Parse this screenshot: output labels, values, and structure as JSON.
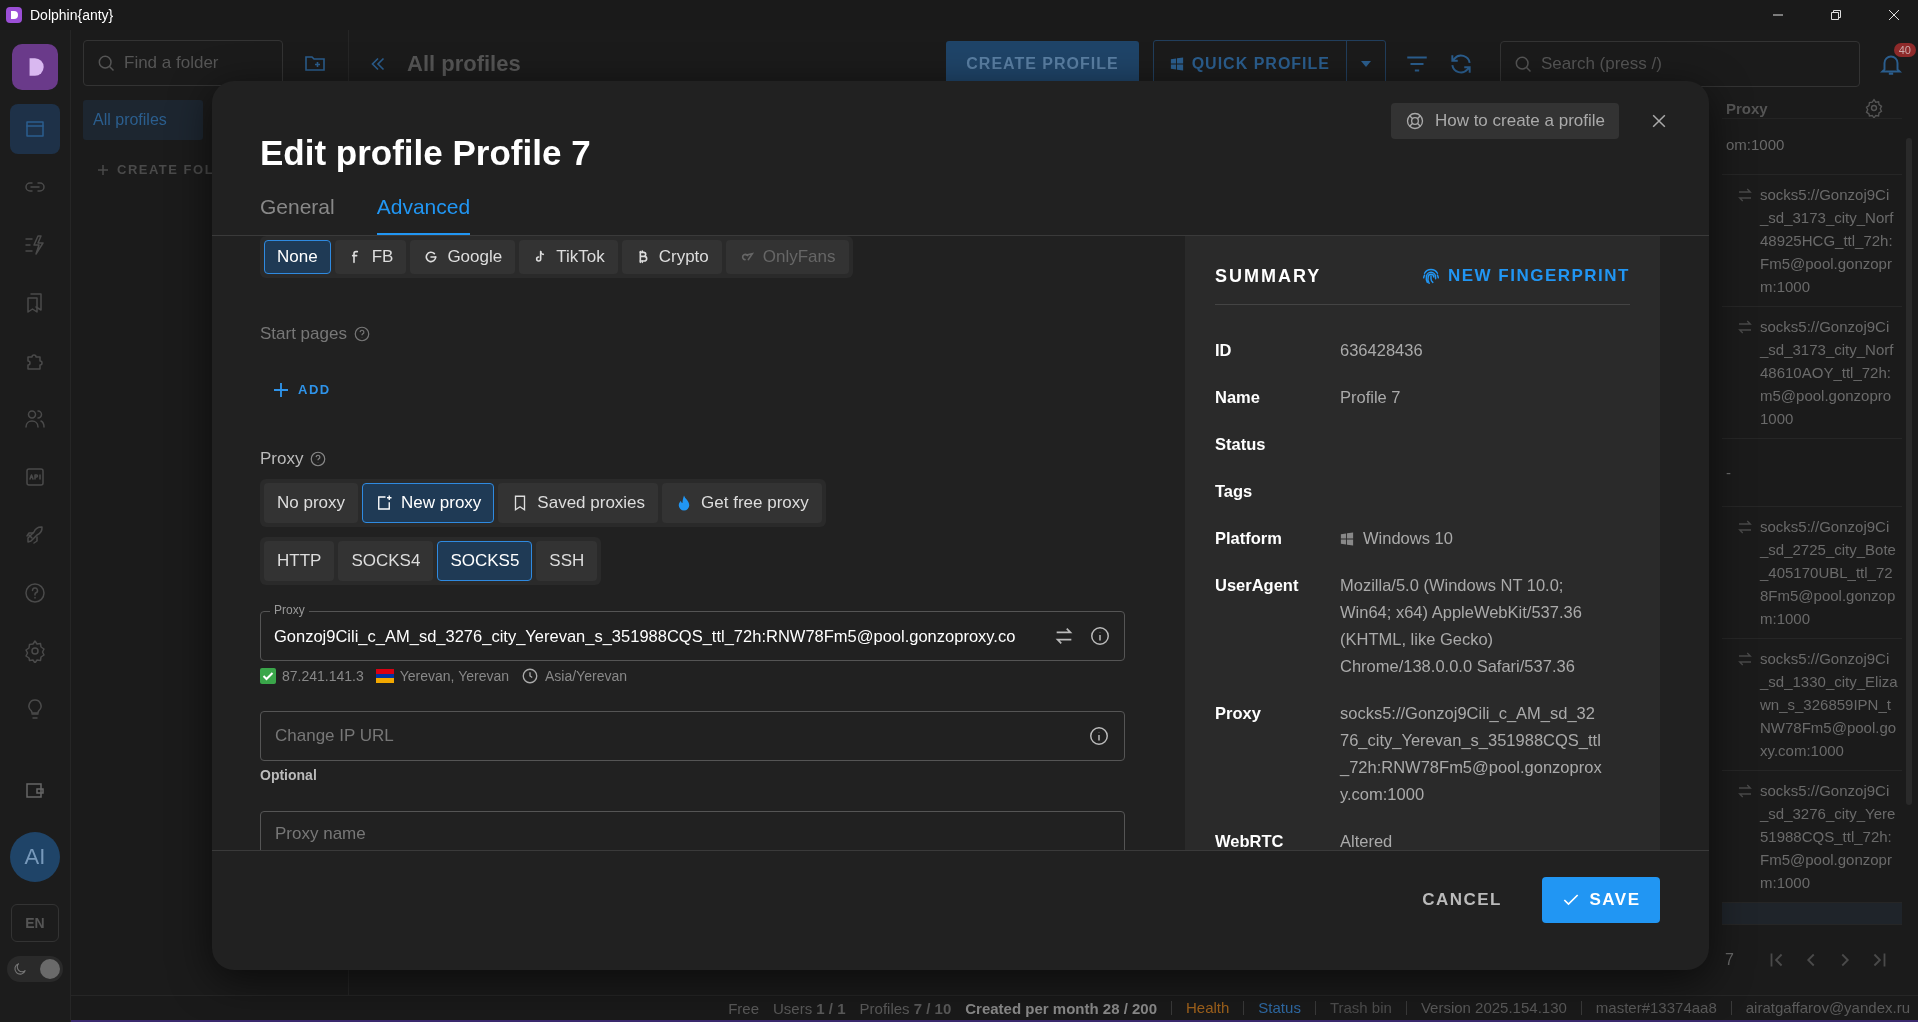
{
  "window": {
    "title": "Dolphin{anty}"
  },
  "rail": {
    "items": [
      {
        "selected": true
      },
      {
        "selected": false
      },
      {
        "selected": false
      },
      {
        "selected": false
      },
      {
        "selected": false
      },
      {
        "selected": false
      },
      {
        "selected": false
      },
      {
        "selected": false
      },
      {
        "selected": false
      },
      {
        "selected": false
      },
      {
        "selected": false
      }
    ],
    "avatar": "AI",
    "language": "EN",
    "dark_mode": true
  },
  "folders": {
    "search_placeholder": "Find a folder",
    "items": [
      {
        "label": "All profiles",
        "selected": true
      }
    ],
    "create": "CREATE FOL"
  },
  "toolbar": {
    "title": "All profiles",
    "create_button": "CREATE PROFILE",
    "quick_button": "QUICK PROFILE",
    "search_placeholder": "Search (press /)",
    "notifications": "40"
  },
  "table": {
    "column": "Proxy",
    "rows": [
      {
        "text": "om:1000",
        "swap": false,
        "selected": false
      },
      {
        "text": "socks5://Gonzoj9Ci\n_sd_3173_city_Norf\n48925HCG_ttl_72h:\nFm5@pool.gonzopr\nm:1000",
        "swap": true,
        "selected": false
      },
      {
        "text": "socks5://Gonzoj9Ci\n_sd_3173_city_Norf\n48610AOY_ttl_72h:\nm5@pool.gonzopro\n1000",
        "swap": true,
        "selected": false
      },
      {
        "text": "-",
        "swap": false,
        "selected": false
      },
      {
        "text": "socks5://Gonzoj9Ci\n_sd_2725_city_Bote\n_405170UBL_ttl_72\n8Fm5@pool.gonzop\nm:1000",
        "swap": true,
        "selected": false
      },
      {
        "text": "socks5://Gonzoj9Ci\n_sd_1330_city_Eliza\nwn_s_326859IPN_t\nNW78Fm5@pool.go\nxy.com:1000",
        "swap": true,
        "selected": false
      },
      {
        "text": "socks5://Gonzoj9Ci\n_sd_3276_city_Yere\n51988CQS_ttl_72h:\nFm5@pool.gonzopr\nm:1000",
        "swap": true,
        "selected": false
      },
      {
        "swap": false,
        "selected": true
      }
    ],
    "page": "7"
  },
  "status_bar": {
    "items": [
      {
        "text": "Free",
        "color": "#5a5a5a",
        "separator": false
      },
      {
        "text": "Users **1 / 1**",
        "color": "#5a5a5a",
        "separator": false
      },
      {
        "text": "Profiles **7 / 10**",
        "color": "#5a5a5a",
        "separator": false
      },
      {
        "text": "**Created per month 28 / 200**",
        "color": "#8a8a8a",
        "separator": false
      },
      {
        "text": "Health",
        "color": "#a0621c",
        "separator": true
      },
      {
        "text": "Status",
        "color": "#2f6aa5",
        "separator": true
      },
      {
        "text": "Trash bin",
        "color": "#4e4e4e",
        "separator": true
      },
      {
        "text": "Version 2025.154.130",
        "color": "#5a5a5a",
        "separator": true
      },
      {
        "text": "master#13374aa8",
        "color": "#5a5a5a",
        "separator": true
      },
      {
        "text": "airatgaffarov@yandex.ru",
        "color": "#5a5a5a",
        "separator": true
      }
    ]
  },
  "modal": {
    "help_button": "How to create a profile",
    "title": "Edit profile Profile 7",
    "tabs": [
      {
        "label": "General",
        "selected": false
      },
      {
        "label": "Advanced",
        "selected": true
      }
    ],
    "presets": [
      {
        "label": "None",
        "selected": true,
        "disabled": false
      },
      {
        "label": "FB",
        "selected": false,
        "disabled": false
      },
      {
        "label": "Google",
        "selected": false,
        "disabled": false
      },
      {
        "label": "TikTok",
        "selected": false,
        "disabled": false
      },
      {
        "label": "Crypto",
        "selected": false,
        "disabled": false
      },
      {
        "label": "OnlyFans",
        "selected": false,
        "disabled": true
      }
    ],
    "start_pages": {
      "label": "Start pages",
      "add": "ADD"
    },
    "proxy": {
      "label": "Proxy",
      "modes": [
        {
          "label": "No proxy",
          "selected": false
        },
        {
          "label": "New proxy",
          "selected": true
        },
        {
          "label": "Saved proxies",
          "selected": false
        },
        {
          "label": "Get free proxy",
          "selected": false
        }
      ],
      "types": [
        {
          "label": "HTTP",
          "selected": false
        },
        {
          "label": "SOCKS4",
          "selected": false
        },
        {
          "label": "SOCKS5",
          "selected": true
        },
        {
          "label": "SSH",
          "selected": false
        }
      ],
      "field_label": "Proxy",
      "value": "Gonzoj9Cili_c_AM_sd_3276_city_Yerevan_s_351988CQS_ttl_72h:RNW78Fm5@pool.gonzoproxy.co",
      "valid": true,
      "ip": "87.241.141.3",
      "location": "Yerevan, Yerevan",
      "timezone": "Asia/Yerevan",
      "change_ip_placeholder": "Change IP URL",
      "change_ip_hint": "Optional",
      "name_placeholder": "Proxy name"
    },
    "summary": {
      "title": "SUMMARY",
      "fingerprint_button": "NEW FINGERPRINT",
      "rows": [
        {
          "label": "ID",
          "value": "636428436",
          "kind": "text"
        },
        {
          "label": "Name",
          "value": "Profile 7",
          "kind": "text"
        },
        {
          "label": "Status"
        },
        {
          "label": "Tags"
        },
        {
          "label": "Platform",
          "value": "Windows 10",
          "kind": "os"
        },
        {
          "label": "UserAgent",
          "value": "Mozilla/5.0 (Windows NT 10.0; Win64; x64) AppleWebKit/537.36 (KHTML, like Gecko) Chrome/138.0.0.0 Safari/537.36",
          "kind": "text"
        },
        {
          "label": "Proxy",
          "value": "socks5://Gonzoj9Cili_c_AM_sd_3276_city_Yerevan_s_351988CQS_ttl_72h:RNW78Fm5@pool.gonzoproxy.com:1000",
          "kind": "break"
        },
        {
          "label": "WebRTC",
          "value": "Altered",
          "kind": "text"
        }
      ]
    },
    "footer": {
      "cancel": "CANCEL",
      "save": "SAVE"
    }
  }
}
